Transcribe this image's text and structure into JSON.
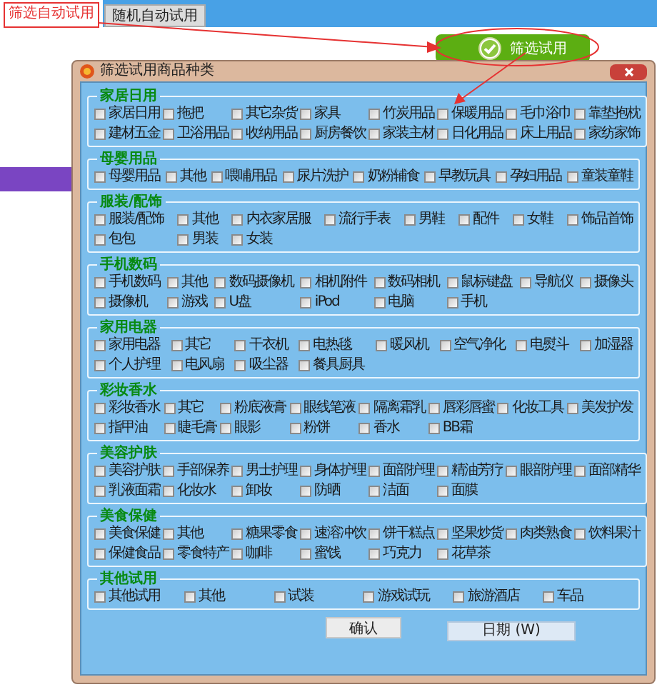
{
  "tabs": [
    {
      "label": "筛选自动试用",
      "selected": true
    },
    {
      "label": "随机自动试用",
      "selected": false
    }
  ],
  "filter_button": {
    "label": "筛选试用"
  },
  "dialog": {
    "title": "筛选试用商品种类",
    "groups": [
      {
        "title": "家居日用",
        "kind": "standard",
        "items": [
          {
            "label": "家居日用",
            "checked": false
          },
          {
            "label": "拖把",
            "checked": false
          },
          {
            "label": "其它杂货",
            "checked": false
          },
          {
            "label": "家具",
            "checked": false
          },
          {
            "label": "竹炭用品",
            "checked": false
          },
          {
            "label": "保暖用品",
            "checked": false
          },
          {
            "label": "毛巾浴巾",
            "checked": false
          },
          {
            "label": "靠垫抱枕",
            "checked": false
          },
          {
            "label": "建材五金",
            "checked": false
          },
          {
            "label": "卫浴用品",
            "checked": false
          },
          {
            "label": "收纳用品",
            "checked": false
          },
          {
            "label": "厨房餐饮",
            "checked": false
          },
          {
            "label": "家装主材",
            "checked": false
          },
          {
            "label": "日化用品",
            "checked": false
          },
          {
            "label": "床上用品",
            "checked": false
          },
          {
            "label": "家纺家饰",
            "checked": false
          }
        ]
      },
      {
        "title": "母婴用品",
        "kind": "standard",
        "items": [
          {
            "label": "母婴用品",
            "checked": false
          },
          {
            "label": "其他",
            "checked": false
          },
          {
            "label": "喂哺用品",
            "checked": false
          },
          {
            "label": "尿片洗护",
            "checked": false
          },
          {
            "label": "奶粉辅食",
            "checked": false
          },
          {
            "label": "早教玩具",
            "checked": false
          },
          {
            "label": "孕妇用品",
            "checked": false
          },
          {
            "label": "童装童鞋",
            "checked": false
          }
        ]
      },
      {
        "title": "服装/配饰",
        "kind": "standard",
        "items": [
          {
            "label": "服装/配饰",
            "checked": false
          },
          {
            "label": "其他",
            "checked": false
          },
          {
            "label": "内衣家居服",
            "checked": false
          },
          {
            "label": "流行手表",
            "checked": false
          },
          {
            "label": "男鞋",
            "checked": false
          },
          {
            "label": "配件",
            "checked": false
          },
          {
            "label": "女鞋",
            "checked": false
          },
          {
            "label": "饰品首饰",
            "checked": false
          },
          {
            "label": "包包",
            "checked": false
          },
          {
            "label": "男装",
            "checked": false
          },
          {
            "label": "女装",
            "checked": false
          }
        ]
      },
      {
        "title": "手机数码",
        "kind": "standard",
        "items": [
          {
            "label": "手机数码",
            "checked": false
          },
          {
            "label": "其他",
            "checked": false
          },
          {
            "label": "数码摄像机",
            "checked": false
          },
          {
            "label": "相机附件",
            "checked": false
          },
          {
            "label": "数码相机",
            "checked": false
          },
          {
            "label": "鼠标键盘",
            "checked": false
          },
          {
            "label": "导航仪",
            "checked": false
          },
          {
            "label": "摄像头",
            "checked": false
          },
          {
            "label": "摄像机",
            "checked": false
          },
          {
            "label": "游戏",
            "checked": false
          },
          {
            "label": "U盘",
            "checked": false
          },
          {
            "label": "iPod",
            "checked": false
          },
          {
            "label": "电脑",
            "checked": false
          },
          {
            "label": "手机",
            "checked": false
          }
        ]
      },
      {
        "title": "家用电器",
        "kind": "standard",
        "items": [
          {
            "label": "家用电器",
            "checked": false
          },
          {
            "label": "其它",
            "checked": false
          },
          {
            "label": "干衣机",
            "checked": false
          },
          {
            "label": "电热毯",
            "checked": false
          },
          {
            "label": "暖风机",
            "checked": false
          },
          {
            "label": "空气净化",
            "checked": false
          },
          {
            "label": "电熨斗",
            "checked": false
          },
          {
            "label": "加湿器",
            "checked": false
          },
          {
            "label": "个人护理",
            "checked": false
          },
          {
            "label": "电风扇",
            "checked": false
          },
          {
            "label": "吸尘器",
            "checked": false
          },
          {
            "label": "餐具厨具",
            "checked": false
          }
        ]
      },
      {
        "title": "彩妆香水",
        "kind": "standard",
        "items": [
          {
            "label": "彩妆香水",
            "checked": false
          },
          {
            "label": "其它",
            "checked": false
          },
          {
            "label": "粉底液膏",
            "checked": false
          },
          {
            "label": "眼线笔液",
            "checked": false
          },
          {
            "label": "隔离霜乳",
            "checked": false
          },
          {
            "label": "唇彩唇蜜",
            "checked": false
          },
          {
            "label": "化妆工具",
            "checked": false
          },
          {
            "label": "美发护发",
            "checked": false
          },
          {
            "label": "指甲油",
            "checked": false
          },
          {
            "label": "睫毛膏",
            "checked": false
          },
          {
            "label": "眼影",
            "checked": false
          },
          {
            "label": "粉饼",
            "checked": false
          },
          {
            "label": "香水",
            "checked": false
          },
          {
            "label": "BB霜",
            "checked": false
          }
        ]
      },
      {
        "title": "美容护肤",
        "kind": "standard",
        "items": [
          {
            "label": "美容护肤",
            "checked": false
          },
          {
            "label": "手部保养",
            "checked": false
          },
          {
            "label": "男士护理",
            "checked": false
          },
          {
            "label": "身体护理",
            "checked": false
          },
          {
            "label": "面部护理",
            "checked": false
          },
          {
            "label": "精油芳疗",
            "checked": false
          },
          {
            "label": "眼部护理",
            "checked": false
          },
          {
            "label": "面部精华",
            "checked": false
          },
          {
            "label": "乳液面霜",
            "checked": false
          },
          {
            "label": "化妆水",
            "checked": false
          },
          {
            "label": "卸妆",
            "checked": false
          },
          {
            "label": "防晒",
            "checked": false
          },
          {
            "label": "洁面",
            "checked": false
          },
          {
            "label": "面膜",
            "checked": false
          }
        ]
      },
      {
        "title": "美食保健",
        "kind": "standard",
        "items": [
          {
            "label": "美食保健",
            "checked": false
          },
          {
            "label": "其他",
            "checked": false
          },
          {
            "label": "糖果零食",
            "checked": false
          },
          {
            "label": "速溶冲饮",
            "checked": false
          },
          {
            "label": "饼干糕点",
            "checked": false
          },
          {
            "label": "坚果炒货",
            "checked": false
          },
          {
            "label": "肉类熟食",
            "checked": false
          },
          {
            "label": "饮料果汁",
            "checked": false
          },
          {
            "label": "保健食品",
            "checked": false
          },
          {
            "label": "零食特产",
            "checked": false
          },
          {
            "label": "咖啡",
            "checked": false
          },
          {
            "label": "蜜饯",
            "checked": false
          },
          {
            "label": "巧克力",
            "checked": false
          },
          {
            "label": "花草茶",
            "checked": false
          }
        ]
      },
      {
        "title": "其他试用",
        "kind": "wide",
        "items": [
          {
            "label": "其他试用",
            "checked": false
          },
          {
            "label": "其他",
            "checked": false
          },
          {
            "label": "试装",
            "checked": false
          },
          {
            "label": "游戏试玩",
            "checked": false
          },
          {
            "label": "旅游酒店",
            "checked": false
          },
          {
            "label": "车品",
            "checked": false
          }
        ]
      }
    ],
    "confirm_button": "确认"
  },
  "popup_menu": {
    "items": [
      {
        "label": "日期 (W)"
      }
    ]
  }
}
